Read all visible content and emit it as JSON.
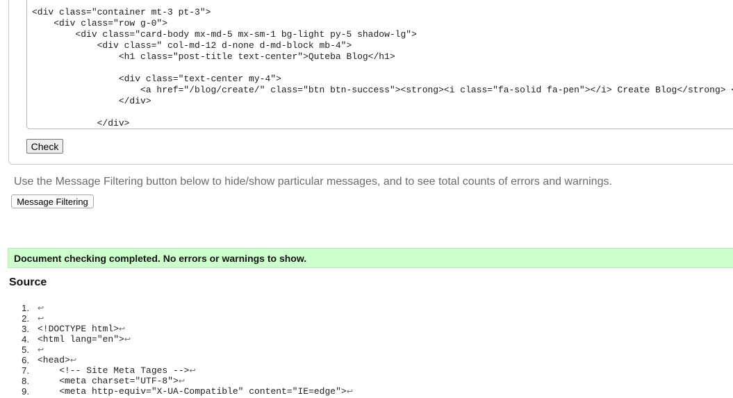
{
  "input_code_lines": [
    "<div class=\"container mt-3 pt-3\">",
    "    <div class=\"row g-0\">",
    "        <div class=\"card-body mx-md-5 mx-sm-1 bg-light py-5 shadow-lg\">",
    "            <div class=\" col-md-12 d-none d-md-block mb-4\">",
    "                <h1 class=\"post-title text-center\">Quteba Blog</h1>",
    "",
    "                <div class=\"text-center my-4\">",
    "                    <a href=\"/blog/create/\" class=\"btn btn-success\"><strong><i class=\"fa-solid fa-pen\"></i> Create Blog</strong> </a>",
    "                </div>",
    "",
    "            </div>"
  ],
  "check_button": "Check",
  "filter_help_text": "Use the Message Filtering button below to hide/show particular messages, and to see total counts of errors and warnings.",
  "message_filtering_button": "Message Filtering",
  "success_message": "Document checking completed. No errors or warnings to show.",
  "success_color": "#ccffcc",
  "source_heading": "Source",
  "source_lines": [
    {
      "num": "1.",
      "code": ""
    },
    {
      "num": "2.",
      "code": ""
    },
    {
      "num": "3.",
      "code": "<!DOCTYPE html>"
    },
    {
      "num": "4.",
      "code": "<html lang=\"en\">"
    },
    {
      "num": "5.",
      "code": ""
    },
    {
      "num": "6.",
      "code": "<head>"
    },
    {
      "num": "7.",
      "code": "    <!-- Site Meta Tages -->"
    },
    {
      "num": "8.",
      "code": "    <meta charset=\"UTF-8\">"
    },
    {
      "num": "9.",
      "code": "    <meta http-equiv=\"X-UA-Compatible\" content=\"IE=edge\">"
    }
  ],
  "line_break_glyph": "↩"
}
